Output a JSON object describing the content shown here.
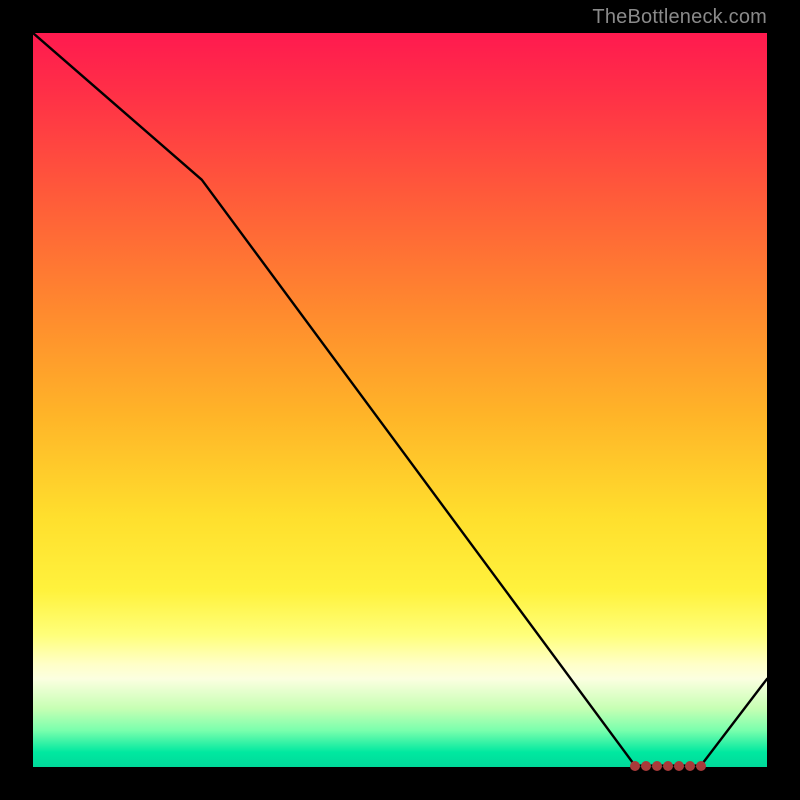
{
  "attribution": "TheBottleneck.com",
  "chart_data": {
    "type": "line",
    "title": "",
    "xlabel": "",
    "ylabel": "",
    "xlim": [
      0,
      100
    ],
    "ylim": [
      0,
      100
    ],
    "x": [
      0,
      23,
      82,
      85,
      91,
      100
    ],
    "values": [
      100,
      80,
      0.2,
      0.2,
      0.2,
      12
    ],
    "markers_x": [
      82,
      83.5,
      85,
      86.5,
      88,
      89.5,
      91
    ],
    "markers_y": [
      0.2,
      0.2,
      0.2,
      0.2,
      0.2,
      0.2,
      0.2
    ],
    "line_color": "#000000",
    "marker_color": "#a83a3a",
    "gradient_stops": [
      {
        "pos": 0,
        "color": "#ff1a4f"
      },
      {
        "pos": 66,
        "color": "#ffdf2d"
      },
      {
        "pos": 86,
        "color": "#ffffc8"
      },
      {
        "pos": 100,
        "color": "#00d99a"
      }
    ]
  }
}
